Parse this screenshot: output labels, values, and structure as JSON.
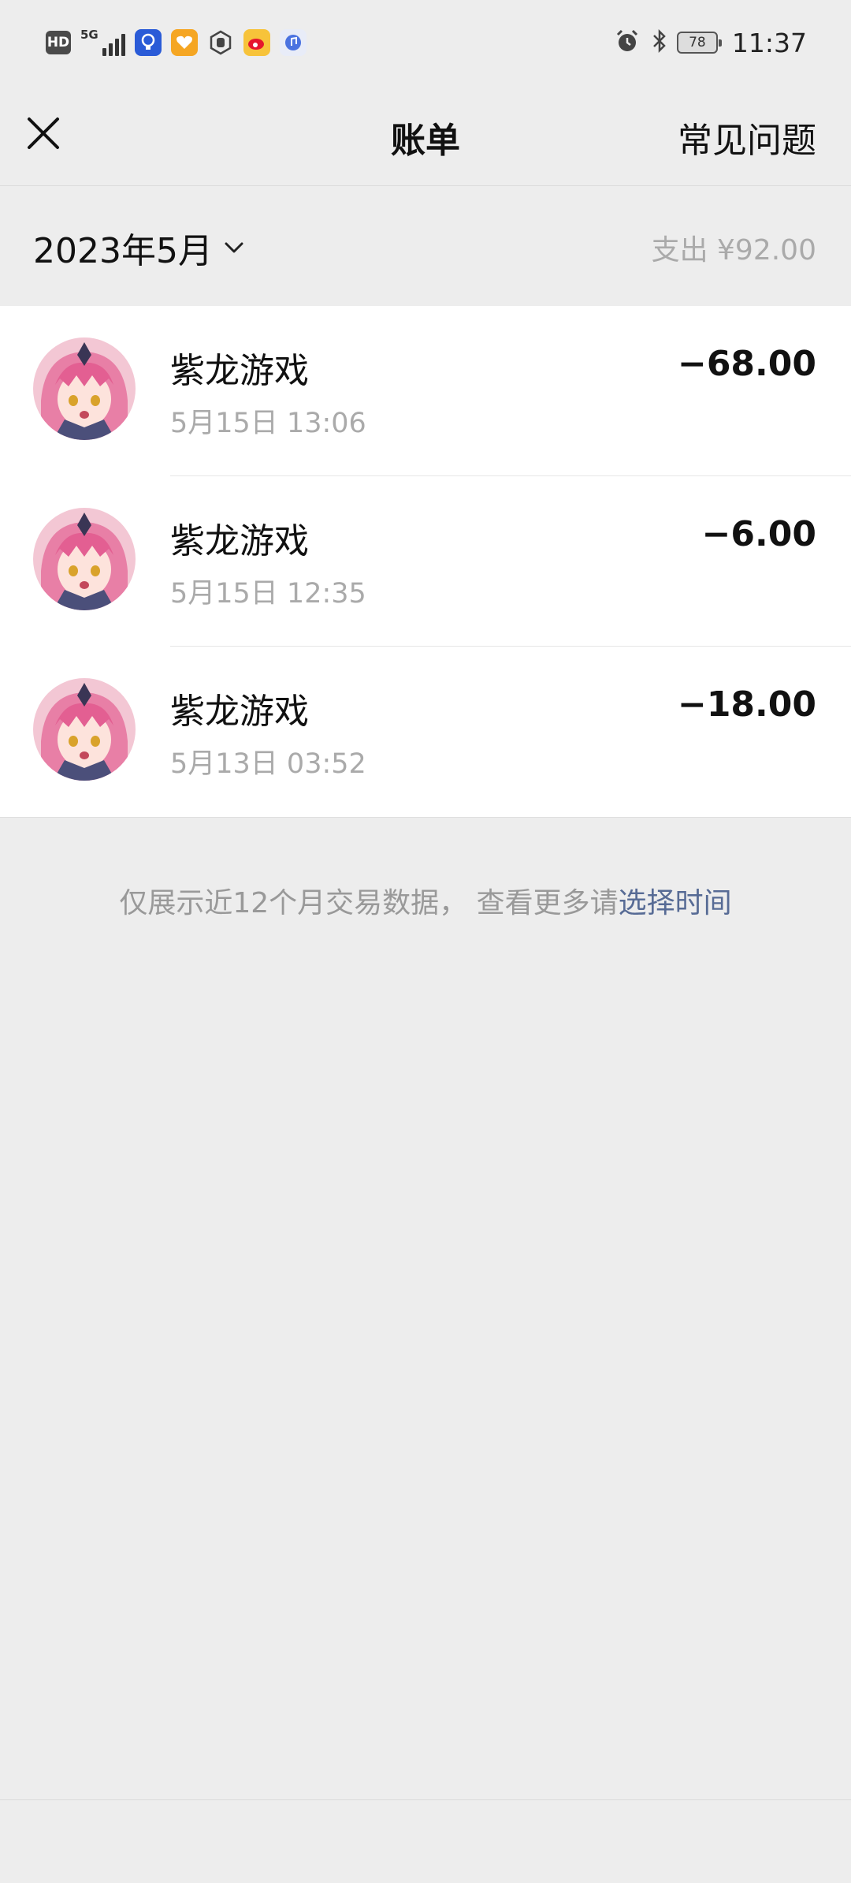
{
  "status_bar": {
    "hd": "HD",
    "network": "5G",
    "battery": "78",
    "time": "11:37"
  },
  "nav": {
    "title": "账单",
    "faq": "常见问题"
  },
  "summary": {
    "month": "2023年5月",
    "total": "支出 ¥92.00"
  },
  "transactions": [
    {
      "title": "紫龙游戏",
      "time": "5月15日 13:06",
      "amount": "−68.00"
    },
    {
      "title": "紫龙游戏",
      "time": "5月15日 12:35",
      "amount": "−6.00"
    },
    {
      "title": "紫龙游戏",
      "time": "5月13日 03:52",
      "amount": "−18.00"
    }
  ],
  "footer": {
    "note": "仅展示近12个月交易数据， 查看更多请",
    "link": "选择时间"
  },
  "colors": {
    "background": "#ededed",
    "link": "#576b95",
    "secondary_text": "#aaaaaa"
  }
}
